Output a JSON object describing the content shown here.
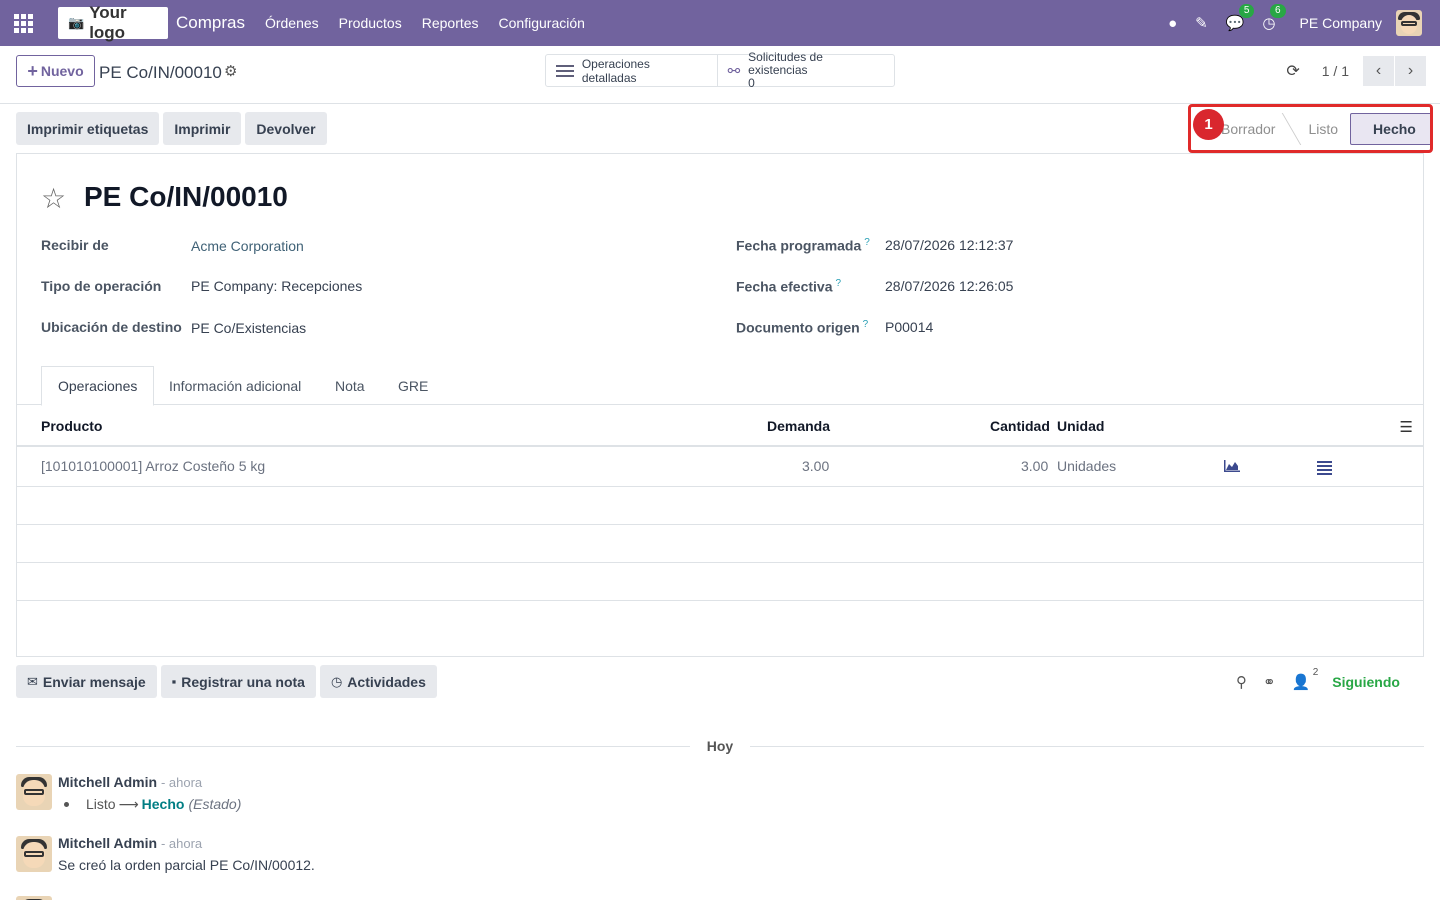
{
  "navbar": {
    "logo_text": "Your logo",
    "app_name": "Compras",
    "menu": [
      "Órdenes",
      "Productos",
      "Reportes",
      "Configuración"
    ],
    "messages_count": "5",
    "activities_count": "6",
    "company": "PE Company"
  },
  "control_panel": {
    "new_label": "Nuevo",
    "record_name": "PE Co/IN/00010",
    "smart_buttons": {
      "detailed_ops": "Operaciones detalladas",
      "stock_requests": "Solicitudes de existencias",
      "stock_requests_count": "0"
    },
    "pager": "1 / 1"
  },
  "actions": {
    "print_labels": "Imprimir etiquetas",
    "print": "Imprimir",
    "return": "Devolver"
  },
  "statusbar": {
    "steps": [
      "Borrador",
      "Listo",
      "Hecho"
    ],
    "active": "Hecho",
    "annotation_number": "1"
  },
  "record": {
    "title": "PE Co/IN/00010",
    "fields_left": [
      {
        "label": "Recibir de",
        "value": "Acme Corporation"
      },
      {
        "label": "Tipo de operación",
        "value": "PE Company: Recepciones"
      },
      {
        "label": "Ubicación de destino",
        "value": "PE Co/Existencias"
      }
    ],
    "fields_right": [
      {
        "label": "Fecha programada",
        "value": "28/07/2026 12:12:37"
      },
      {
        "label": "Fecha efectiva",
        "value": "28/07/2026 12:26:05"
      },
      {
        "label": "Documento origen",
        "value": "P00014"
      }
    ],
    "help_mark": "?"
  },
  "tabs": [
    "Operaciones",
    "Información adicional",
    "Nota",
    "GRE"
  ],
  "table": {
    "columns": {
      "product": "Producto",
      "demand": "Demanda",
      "quantity": "Cantidad",
      "unit": "Unidad"
    },
    "rows": [
      {
        "product": "[101010100001] Arroz Costeño 5 kg",
        "demand": "3.00",
        "quantity": "3.00",
        "unit": "Unidades"
      }
    ]
  },
  "chatter": {
    "send_message": "Enviar mensaje",
    "log_note": "Registrar una nota",
    "activities": "Actividades",
    "followers_count": "2",
    "following": "Siguiendo",
    "date_separator": "Hoy",
    "messages": [
      {
        "author": "Mitchell Admin",
        "time": "- ahora",
        "old_value": "Listo",
        "new_value": "Hecho",
        "field": "(Estado)"
      },
      {
        "author": "Mitchell Admin",
        "time": "- ahora",
        "body": "Se creó la orden parcial PE Co/IN/00012."
      }
    ]
  },
  "colors": {
    "brand": "#71639e",
    "following": "#28a745",
    "highlight": "#e02a2a"
  }
}
